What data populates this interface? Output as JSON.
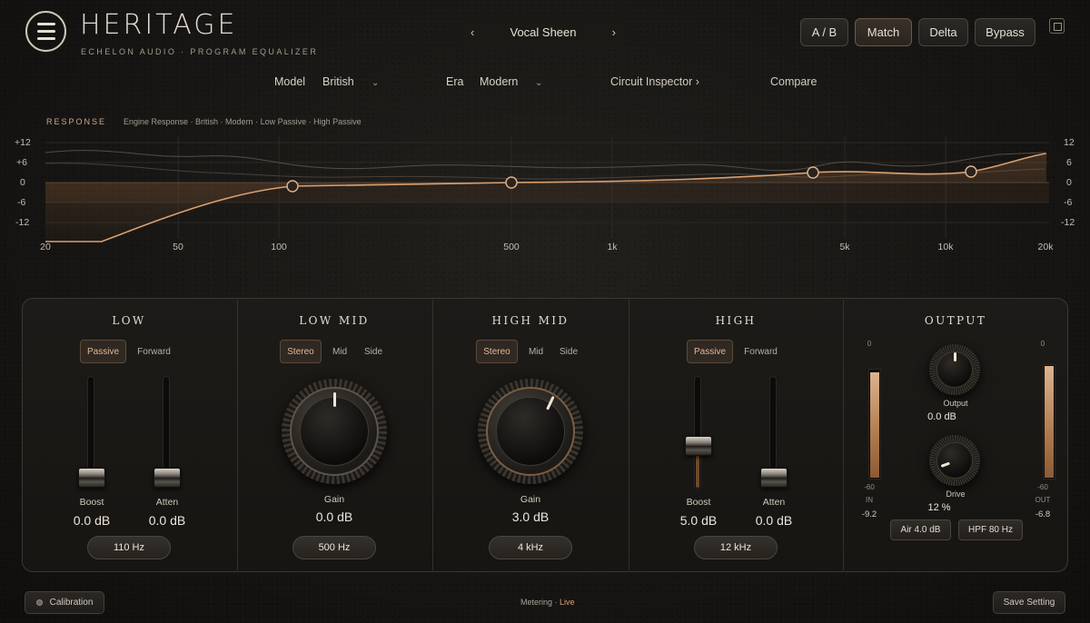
{
  "header": {
    "title": "HERITAGE",
    "subtitle": "ECHELON AUDIO · PROGRAM EQUALIZER",
    "preset_prev": "‹",
    "preset_name": "Vocal Sheen",
    "preset_next": "›",
    "buttons": {
      "ab": "A / B",
      "match": "Match",
      "delta": "Delta",
      "bypass": "Bypass"
    }
  },
  "model_bar": {
    "model_label": "Model",
    "model_value": "British",
    "era_label": "Era",
    "era_value": "Modern",
    "inspector": "Circuit Inspector ›",
    "compare": "Compare"
  },
  "response": {
    "title": "RESPONSE",
    "subtitle": "Engine Response · British · Modern · Low Passive · High Passive",
    "y_ticks_left": [
      "+12",
      "+6",
      "0",
      "-6",
      "-12"
    ],
    "y_ticks_right": [
      "12",
      "6",
      "0",
      "-6",
      "-12"
    ],
    "x_ticks": [
      "20",
      "50",
      "100",
      "500",
      "1k",
      "5k",
      "10k",
      "20k"
    ],
    "accent": "#d9a070"
  },
  "bands": {
    "low": {
      "title": "LOW",
      "modes": [
        "Passive",
        "Forward"
      ],
      "active_mode": "Passive",
      "boost_label": "Boost",
      "boost_value": "0.0 dB",
      "boost_level": 0.0,
      "atten_label": "Atten",
      "atten_value": "0.0 dB",
      "atten_level": 0.0,
      "freq": "110 Hz"
    },
    "low_mid": {
      "title": "LOW MID",
      "modes": [
        "Stereo",
        "Mid",
        "Side"
      ],
      "active_mode": "Stereo",
      "gain_label": "Gain",
      "gain_value": "0.0 dB",
      "freq": "500 Hz"
    },
    "high_mid": {
      "title": "HIGH MID",
      "modes": [
        "Stereo",
        "Mid",
        "Side"
      ],
      "active_mode": "Stereo",
      "gain_label": "Gain",
      "gain_value": "3.0 dB",
      "freq": "4 kHz"
    },
    "high": {
      "title": "HIGH",
      "modes": [
        "Passive",
        "Forward"
      ],
      "active_mode": "Passive",
      "boost_label": "Boost",
      "boost_value": "5.0 dB",
      "boost_level": 0.5,
      "atten_label": "Atten",
      "atten_value": "0.0 dB",
      "atten_level": 0.0,
      "freq": "12 kHz"
    },
    "output": {
      "title": "OUTPUT",
      "output_label": "Output",
      "output_value": "0.0 dB",
      "drive_label": "Drive",
      "drive_value": "12 %",
      "in_meter": {
        "top": "0",
        "bottom": "-60",
        "label": "IN",
        "value": "-9.2"
      },
      "out_meter": {
        "top": "0",
        "bottom": "-60",
        "label": "OUT",
        "value": "-6.8"
      },
      "air_button": "Air 4.0 dB",
      "hpf_button": "HPF 80 Hz"
    }
  },
  "footer": {
    "calibration": "Calibration",
    "metering_label": "Metering ·",
    "metering_state": "Live",
    "save": "Save Setting"
  }
}
